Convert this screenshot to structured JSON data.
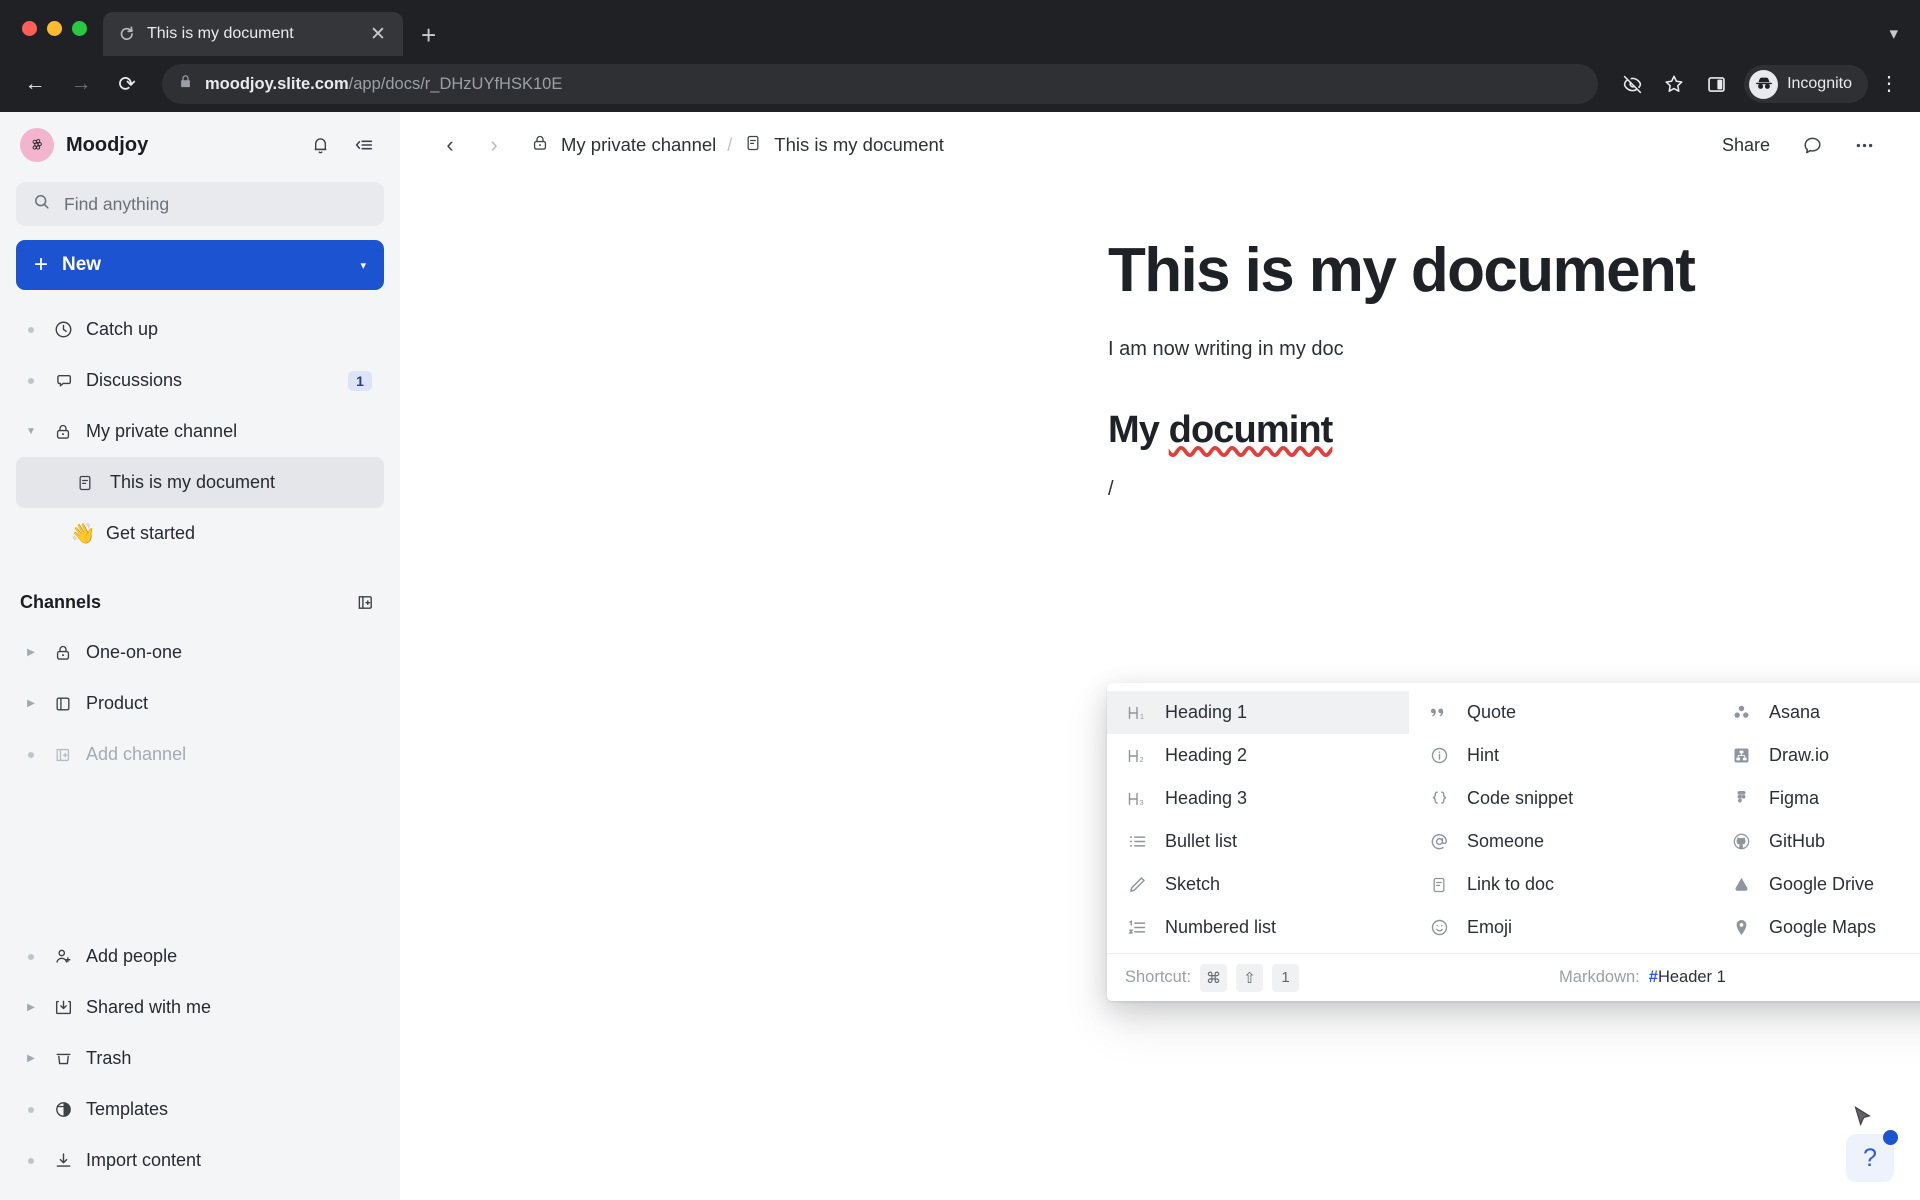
{
  "browser": {
    "tab": {
      "title": "This is my document",
      "favicon_icon": "slite-logo-icon",
      "close_icon": "close-icon"
    },
    "new_tab_label": "+",
    "tabstrip_chevron": "▾",
    "back_icon": "←",
    "forward_icon": "→",
    "reload_icon": "⟳",
    "url_domain": "moodjoy.slite.com",
    "url_path": "/app/docs/r_DHzUYfHSK10E",
    "lock_icon": "lock-icon",
    "toolbar_icons": [
      "eye-off-icon",
      "star-icon",
      "side-panel-icon"
    ],
    "profile_label": "Incognito",
    "menu_icon": "kebab-menu-icon"
  },
  "sidebar": {
    "workspace": "Moodjoy",
    "logo_icon": "moodjoy-berry-logo",
    "bell_icon": "bell-icon",
    "collapse_icon": "collapse-sidebar-icon",
    "search": {
      "placeholder": "Find anything",
      "icon": "search-icon"
    },
    "new_button": {
      "label": "New",
      "plus": "+",
      "caret": "▾"
    },
    "nav": [
      {
        "label": "Catch up",
        "icon": "clock-icon",
        "twist": "dot"
      },
      {
        "label": "Discussions",
        "icon": "chat-bubble-icon",
        "twist": "dot",
        "badge": "1"
      },
      {
        "label": "My private channel",
        "icon": "lock-icon",
        "twist": "down"
      }
    ],
    "private_children": [
      {
        "label": "This is my document",
        "icon": "doc-icon",
        "active": true
      },
      {
        "label": "Get started",
        "emoji": "👋",
        "active": false
      }
    ],
    "channels_section": {
      "title": "Channels",
      "add_icon": "add-channel-icon"
    },
    "channels": [
      {
        "label": "One-on-one",
        "icon": "lock-icon",
        "twist": "right"
      },
      {
        "label": "Product",
        "icon": "channel-icon",
        "twist": "right"
      },
      {
        "label": "Add channel",
        "icon": "add-channel-icon",
        "twist": "dot",
        "muted": true
      }
    ],
    "bottom": [
      {
        "label": "Add people",
        "icon": "add-person-icon",
        "twist": "dot"
      },
      {
        "label": "Shared with me",
        "icon": "inbox-down-icon",
        "twist": "right"
      },
      {
        "label": "Trash",
        "icon": "trash-icon",
        "twist": "right"
      },
      {
        "label": "Templates",
        "icon": "templates-icon",
        "twist": "dot"
      },
      {
        "label": "Import content",
        "icon": "import-icon",
        "twist": "dot"
      }
    ]
  },
  "topbar": {
    "back_icon": "chevron-left-icon",
    "forward_icon": "chevron-right-icon",
    "breadcrumb": [
      {
        "label": "My private channel",
        "icon": "lock-icon"
      },
      {
        "label": "This is my document",
        "icon": "doc-icon"
      }
    ],
    "separator": "/",
    "share_label": "Share",
    "comment_icon": "comment-icon",
    "more_icon": "more-horizontal-icon"
  },
  "document": {
    "title": "This is my document",
    "paragraph": "I am now writing in my doc",
    "heading2": "My documint",
    "heading2_misspelled_word": "documint",
    "slash_text": "/"
  },
  "slash_menu": {
    "columns": [
      [
        {
          "label": "Heading 1",
          "icon": "heading-1-icon",
          "selected": true
        },
        {
          "label": "Heading 2",
          "icon": "heading-2-icon"
        },
        {
          "label": "Heading 3",
          "icon": "heading-3-icon"
        },
        {
          "label": "Bullet list",
          "icon": "bullet-list-icon"
        },
        {
          "label": "Sketch",
          "icon": "pencil-icon"
        },
        {
          "label": "Numbered list",
          "icon": "numbered-list-icon"
        }
      ],
      [
        {
          "label": "Quote",
          "icon": "quote-icon"
        },
        {
          "label": "Hint",
          "icon": "info-circle-icon"
        },
        {
          "label": "Code snippet",
          "icon": "curly-braces-icon"
        },
        {
          "label": "Someone",
          "icon": "at-mention-icon"
        },
        {
          "label": "Link to doc",
          "icon": "doc-icon"
        },
        {
          "label": "Emoji",
          "icon": "smiley-icon"
        }
      ],
      [
        {
          "label": "Asana",
          "icon": "asana-icon"
        },
        {
          "label": "Draw.io",
          "icon": "drawio-icon"
        },
        {
          "label": "Figma",
          "icon": "figma-icon"
        },
        {
          "label": "GitHub",
          "icon": "github-icon"
        },
        {
          "label": "Google Drive",
          "icon": "google-drive-icon"
        },
        {
          "label": "Google Maps",
          "icon": "google-maps-icon"
        }
      ]
    ],
    "footer": {
      "shortcut_label": "Shortcut:",
      "keys": [
        "⌘",
        "⇧",
        "1"
      ],
      "markdown_label": "Markdown:",
      "markdown_hash": "#",
      "markdown_value": "Header 1"
    }
  },
  "help_widget": {
    "label": "?",
    "has_notification_dot": true
  },
  "colors": {
    "accent": "#1b53d0",
    "sidebar_bg": "#f4f5f7",
    "chrome_bg": "#202124",
    "spellcheck": "#e0403a"
  }
}
